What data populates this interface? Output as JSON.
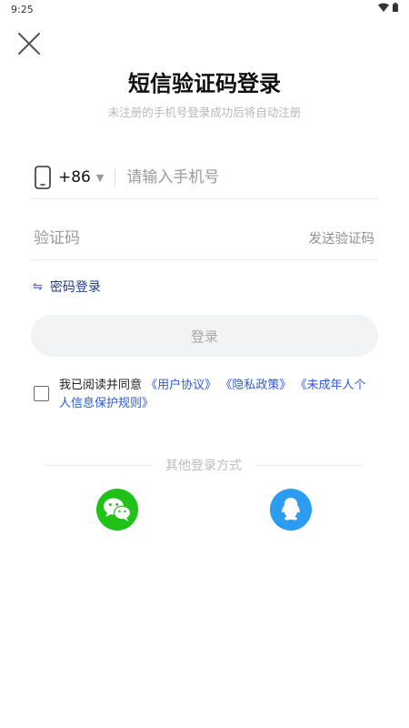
{
  "status_bar": {
    "time": "9:25"
  },
  "title": "短信验证码登录",
  "subtitle": "未注册的手机号登录成功后将自动注册",
  "phone": {
    "country_code": "+86",
    "placeholder": "请输入手机号",
    "value": ""
  },
  "code": {
    "placeholder": "验证码",
    "value": "",
    "send_label": "发送验证码"
  },
  "switch_login_label": "密码登录",
  "login_button_label": "登录",
  "agreement": {
    "prefix": "我已阅读并同意",
    "user_agreement": "《用户协议》",
    "privacy_policy": "《隐私政策》",
    "minor_rules": "《未成年人个人信息保护规则》",
    "checked": false
  },
  "other_login": {
    "label": "其他登录方式",
    "providers": [
      {
        "name": "wechat",
        "icon": "wechat-icon",
        "color": "#20c21a"
      },
      {
        "name": "qq",
        "icon": "qq-icon",
        "color": "#2b9cf0"
      }
    ]
  }
}
